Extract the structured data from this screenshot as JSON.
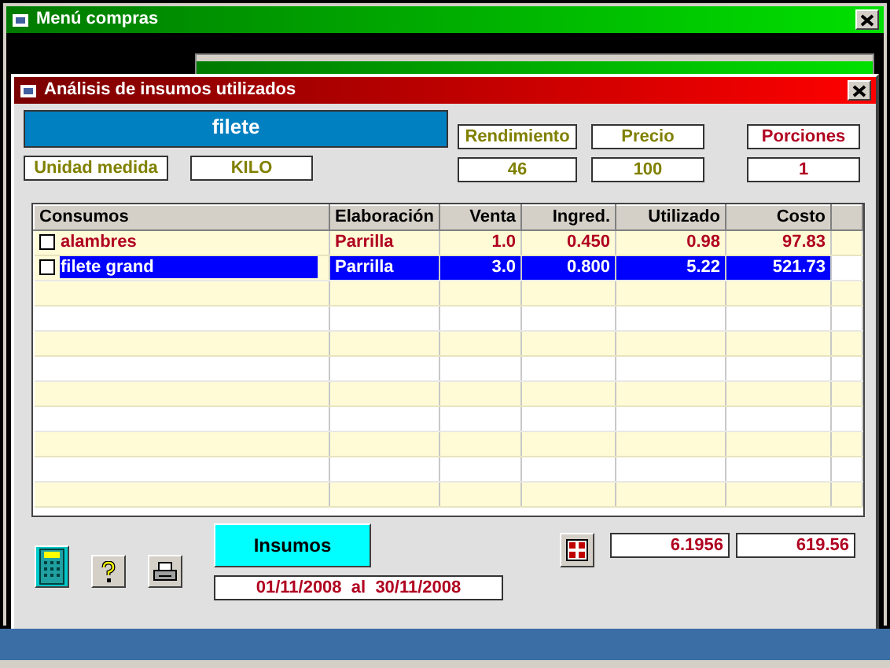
{
  "window": {
    "title": "Menú compras"
  },
  "dialog": {
    "title": "Análisis de insumos utilizados",
    "item_name": "filete",
    "unit_label": "Unidad medida",
    "unit_value": "KILO",
    "stats": [
      {
        "label": "Rendimiento",
        "value": "46",
        "kind": "normal"
      },
      {
        "label": "Precio",
        "value": "100",
        "kind": "normal"
      },
      {
        "label": "Porciones",
        "value": "1",
        "kind": "highlight"
      }
    ]
  },
  "table": {
    "columns": [
      "Consumos",
      "Elaboración",
      "Venta",
      "Ingred.",
      "Utilizado",
      "Costo"
    ],
    "rows": [
      {
        "cells": [
          "alambres",
          "Parrilla",
          "1.0",
          "0.450",
          "0.98",
          "97.83"
        ],
        "checked": false,
        "selected": false
      },
      {
        "cells": [
          "filete grand",
          "Parrilla",
          "3.0",
          "0.800",
          "5.22",
          "521.73"
        ],
        "checked": false,
        "selected": true
      }
    ]
  },
  "insumos_button": "Insumos",
  "date_range": "01/11/2008  al  30/11/2008",
  "totals": [
    "6.1956",
    "619.56"
  ]
}
